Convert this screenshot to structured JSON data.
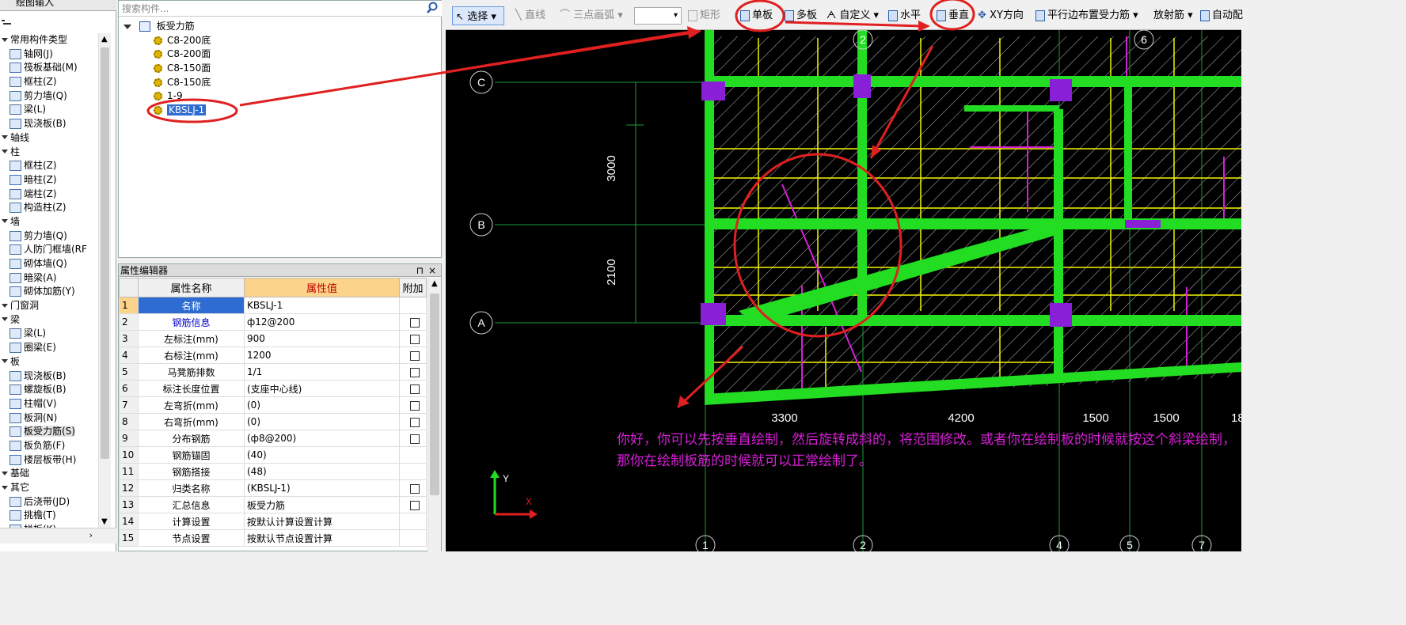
{
  "left_tree": {
    "top_label": "绘图输入",
    "items": [
      {
        "type": "cat",
        "label": "常用构件类型"
      },
      {
        "type": "item",
        "label": "轴网(J)",
        "icon": "grid-icon"
      },
      {
        "type": "item",
        "label": "筏板基础(M)",
        "icon": "raft-icon"
      },
      {
        "type": "item",
        "label": "框柱(Z)",
        "icon": "column-icon"
      },
      {
        "type": "item",
        "label": "剪力墙(Q)",
        "icon": "wall-icon"
      },
      {
        "type": "item",
        "label": "梁(L)",
        "icon": "beam-icon"
      },
      {
        "type": "item",
        "label": "现浇板(B)",
        "icon": "slab-icon"
      },
      {
        "type": "cat",
        "label": "轴线"
      },
      {
        "type": "cat",
        "label": "柱"
      },
      {
        "type": "item",
        "label": "框柱(Z)",
        "icon": "column-icon"
      },
      {
        "type": "item",
        "label": "暗柱(Z)",
        "icon": "column-icon"
      },
      {
        "type": "item",
        "label": "端柱(Z)",
        "icon": "column-icon"
      },
      {
        "type": "item",
        "label": "构造柱(Z)",
        "icon": "column-icon"
      },
      {
        "type": "cat",
        "label": "墙"
      },
      {
        "type": "item",
        "label": "剪力墙(Q)",
        "icon": "wall-icon"
      },
      {
        "type": "item",
        "label": "人防门框墙(RF",
        "icon": "door-wall-icon"
      },
      {
        "type": "item",
        "label": "砌体墙(Q)",
        "icon": "brick-wall-icon"
      },
      {
        "type": "item",
        "label": "暗梁(A)",
        "icon": "beam-icon"
      },
      {
        "type": "item",
        "label": "砌体加筋(Y)",
        "icon": "rebar-icon"
      },
      {
        "type": "cat",
        "label": "门窗洞"
      },
      {
        "type": "cat",
        "label": "梁"
      },
      {
        "type": "item",
        "label": "梁(L)",
        "icon": "beam-icon"
      },
      {
        "type": "item",
        "label": "圈梁(E)",
        "icon": "beam-icon"
      },
      {
        "type": "cat",
        "label": "板"
      },
      {
        "type": "item",
        "label": "现浇板(B)",
        "icon": "slab-icon"
      },
      {
        "type": "item",
        "label": "螺旋板(B)",
        "icon": "spiral-slab-icon"
      },
      {
        "type": "item",
        "label": "柱帽(V)",
        "icon": "column-cap-icon"
      },
      {
        "type": "item",
        "label": "板洞(N)",
        "icon": "slab-hole-icon"
      },
      {
        "type": "item",
        "label": "板受力筋(S)",
        "icon": "slab-rebar-icon",
        "selected": true
      },
      {
        "type": "item",
        "label": "板负筋(F)",
        "icon": "neg-rebar-icon"
      },
      {
        "type": "item",
        "label": "楼层板带(H)",
        "icon": "slab-strip-icon"
      },
      {
        "type": "cat",
        "label": "基础"
      },
      {
        "type": "cat",
        "label": "其它"
      },
      {
        "type": "item",
        "label": "后浇带(JD)",
        "icon": "post-cast-icon"
      },
      {
        "type": "item",
        "label": "挑檐(T)",
        "icon": "eave-icon"
      },
      {
        "type": "item",
        "label": "栏板(K)",
        "icon": "parapet-icon"
      }
    ]
  },
  "components": {
    "search_placeholder": "搜索构件...",
    "root": "板受力筋",
    "items": [
      "C8-200底",
      "C8-200面",
      "C8-150面",
      "C8-150底",
      "1-9",
      "KBSLJ-1"
    ],
    "selected_index": 5
  },
  "properties": {
    "title": "属性编辑器",
    "headers": {
      "no": "",
      "name": "属性名称",
      "value": "属性值",
      "extra": "附加"
    },
    "rows": [
      {
        "no": "1",
        "name": "名称",
        "value": "KBSLJ-1",
        "check": false,
        "blue": true,
        "hl": true
      },
      {
        "no": "2",
        "name": "钢筋信息",
        "value": "ф12@200",
        "check": true,
        "blue": true
      },
      {
        "no": "3",
        "name": "左标注(mm)",
        "value": "900",
        "check": true
      },
      {
        "no": "4",
        "name": "右标注(mm)",
        "value": "1200",
        "check": true
      },
      {
        "no": "5",
        "name": "马凳筋排数",
        "value": "1/1",
        "check": true
      },
      {
        "no": "6",
        "name": "标注长度位置",
        "value": "(支座中心线)",
        "check": true
      },
      {
        "no": "7",
        "name": "左弯折(mm)",
        "value": "(0)",
        "check": true
      },
      {
        "no": "8",
        "name": "右弯折(mm)",
        "value": "(0)",
        "check": true
      },
      {
        "no": "9",
        "name": "分布钢筋",
        "value": "(ф8@200)",
        "check": true
      },
      {
        "no": "10",
        "name": "钢筋锚固",
        "value": "(40)",
        "check": false
      },
      {
        "no": "11",
        "name": "钢筋搭接",
        "value": "(48)",
        "check": false
      },
      {
        "no": "12",
        "name": "归类名称",
        "value": "(KBSLJ-1)",
        "check": true
      },
      {
        "no": "13",
        "name": "汇总信息",
        "value": "板受力筋",
        "check": true
      },
      {
        "no": "14",
        "name": "计算设置",
        "value": "按默认计算设置计算",
        "check": false
      },
      {
        "no": "15",
        "name": "节点设置",
        "value": "按默认节点设置计算",
        "check": false
      }
    ]
  },
  "toolbar": {
    "select": "选择",
    "line": "直线",
    "arc": "三点画弧",
    "rect": "矩形",
    "single": "单板",
    "multi": "多板",
    "custom": "自定义",
    "horizontal": "水平",
    "vertical": "垂直",
    "xy": "XY方向",
    "parallel": "平行边布置受力筋",
    "radial": "放射筋",
    "auto": "自动配"
  },
  "canvas": {
    "axis_rows": [
      "C",
      "B",
      "A"
    ],
    "axis_cols_top": [
      "2",
      "6"
    ],
    "axis_cols_bottom": [
      "1",
      "2",
      "4",
      "5",
      "7"
    ],
    "dims_vertical": [
      "3000",
      "2100"
    ],
    "dims_horizontal": [
      "3300",
      "4200",
      "1500",
      "1500",
      "18"
    ],
    "ucs": {
      "y": "Y",
      "x": "X"
    },
    "callout": "你好，你可以先按垂直绘制，然后旋转成斜的，将范围修改。或者你在绘制板的时候就按这个斜梁绘制，那你在绘制板筋的时候就可以正常绘制了。",
    "colors": {
      "wall": "#22dd22",
      "rebar": "#f5f500",
      "magenta": "#d81fd8",
      "annotation": "#e02020",
      "column": "#8a1fd8"
    }
  }
}
